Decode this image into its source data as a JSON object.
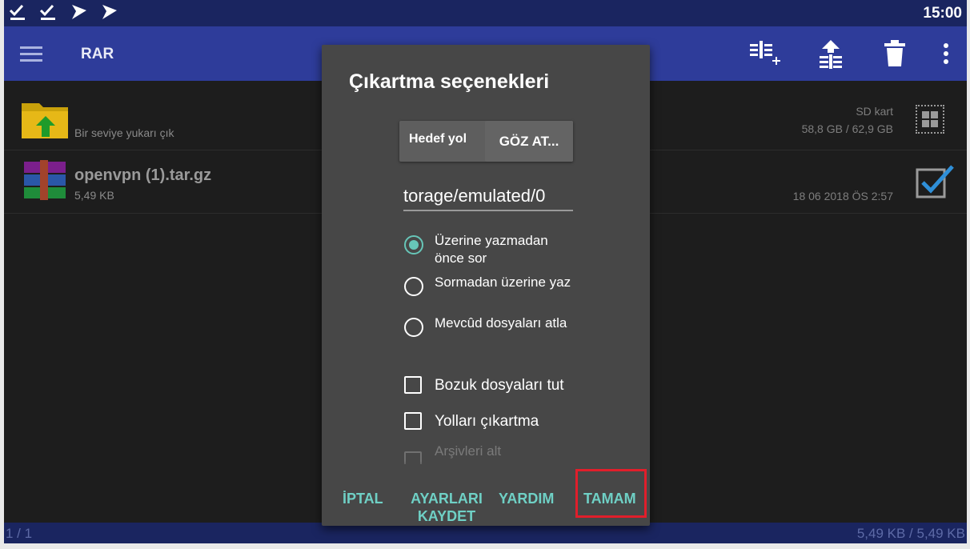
{
  "status_bar": {
    "time": "15:00",
    "icons": [
      "download-done-icon",
      "download-done-icon",
      "send-icon",
      "send-icon"
    ]
  },
  "app_bar": {
    "title": "RAR",
    "actions": [
      "add-to-archive-icon",
      "extract-icon",
      "delete-icon",
      "more-vert-icon"
    ]
  },
  "file_list": {
    "up_row": {
      "label": "Bir seviye yukarı çık",
      "storage_name": "SD kart",
      "storage_space": "58,8 GB / 62,9 GB"
    },
    "files": [
      {
        "name": "openvpn (1).tar.gz",
        "size": "5,49 KB",
        "date": "18 06 2018 ÖS 2:57",
        "selected": true
      }
    ]
  },
  "bottom_bar": {
    "page": "1 / 1",
    "total_size": "5,49 KB / 5,49 KB"
  },
  "dialog": {
    "title": "Çıkartma seçenekleri",
    "dest_label": "Hedef yol",
    "browse_label": "GÖZ AT...",
    "path_value": "torage/emulated/0",
    "overwrite_options": [
      {
        "label": "Üzerine yazmadan önce sor",
        "checked": true
      },
      {
        "label": "Sormadan üzerine yaz",
        "checked": false
      },
      {
        "label": "Mevcûd dosyaları atla",
        "checked": false
      }
    ],
    "checkboxes": [
      {
        "label": "Bozuk dosyaları tut",
        "checked": false
      },
      {
        "label": "Yolları çıkartma",
        "checked": false
      },
      {
        "label": "Arşivleri alt",
        "checked": false,
        "disabled": true
      }
    ],
    "buttons": {
      "cancel": "İPTAL",
      "save_settings": "AYARLARI KAYDET",
      "help": "YARDIM",
      "ok": "TAMAM"
    }
  },
  "colors": {
    "accent": "#6fd0c5",
    "highlight": "#e11e2b",
    "app_bar": "#2e3c9a",
    "status_bar": "#1a2560"
  }
}
